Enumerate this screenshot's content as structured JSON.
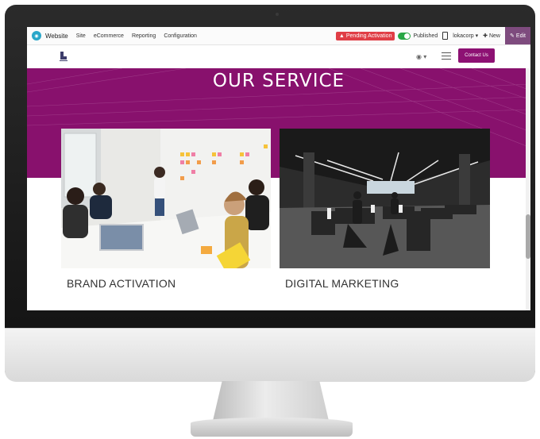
{
  "topbar": {
    "app_name": "Website",
    "menu": [
      "Site",
      "eCommerce",
      "Reporting",
      "Configuration"
    ],
    "pending_label": "Pending Activation",
    "published_label": "Published",
    "company": "lokacorp",
    "new_label": "New",
    "edit_label": "Edit"
  },
  "site_header": {
    "contact_label": "Contact Us"
  },
  "hero": {
    "title": "OUR SERVICE"
  },
  "services": [
    {
      "label": "BRAND ACTIVATION"
    },
    {
      "label": "DIGITAL MARKETING"
    }
  ],
  "colors": {
    "brand_purple": "#88116d",
    "pending_red": "#e03e46",
    "published_green": "#28a745",
    "edit_purple": "#7e4b7e"
  }
}
